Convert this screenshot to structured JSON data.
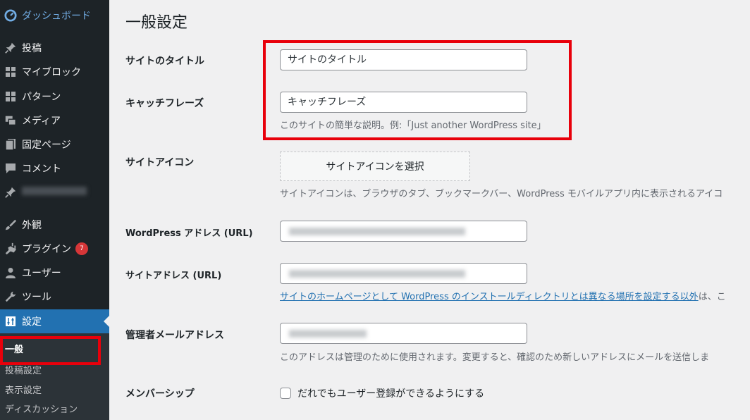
{
  "sidebar": {
    "dashboard": "ダッシュボード",
    "items": [
      {
        "label": "投稿",
        "icon": "pin-icon"
      },
      {
        "label": "マイブロック",
        "icon": "grid-icon"
      },
      {
        "label": "パターン",
        "icon": "grid-icon"
      },
      {
        "label": "メディア",
        "icon": "media-icon"
      },
      {
        "label": "固定ページ",
        "icon": "page-icon"
      },
      {
        "label": "コメント",
        "icon": "comment-icon"
      },
      {
        "label": "",
        "icon": "pin-icon"
      },
      {
        "label": "外観",
        "icon": "brush-icon"
      },
      {
        "label": "プラグイン",
        "icon": "plugin-icon",
        "badge": "7"
      },
      {
        "label": "ユーザー",
        "icon": "user-icon"
      },
      {
        "label": "ツール",
        "icon": "wrench-icon"
      },
      {
        "label": "設定",
        "icon": "settings-icon"
      }
    ],
    "submenu": [
      "一般",
      "投稿設定",
      "表示設定",
      "ディスカッション"
    ]
  },
  "main": {
    "title": "一般設定",
    "site_title": {
      "label": "サイトのタイトル",
      "value": "サイトのタイトル"
    },
    "tagline": {
      "label": "キャッチフレーズ",
      "value": "キャッチフレーズ",
      "description": "このサイトの簡単な説明。例:「Just another WordPress site」"
    },
    "site_icon": {
      "label": "サイトアイコン",
      "button": "サイトアイコンを選択",
      "description": "サイトアイコンは、ブラウザのタブ、ブックマークバー、WordPress モバイルアプリ内に表示されるアイコ"
    },
    "wp_address": {
      "label": "WordPress アドレス (URL)"
    },
    "site_address": {
      "label": "サイトアドレス (URL)",
      "link": "サイトのホームページとして WordPress のインストールディレクトリとは異なる場所を設定する以外",
      "suffix": "は、こ"
    },
    "admin_email": {
      "label": "管理者メールアドレス",
      "description": "このアドレスは管理のために使用されます。変更すると、確認のため新しいアドレスにメールを送信しま"
    },
    "membership": {
      "label": "メンバーシップ",
      "checkbox_label": "だれでもユーザー登録ができるようにする"
    }
  },
  "colors": {
    "sidebar": "#1d2327",
    "active": "#2271b1",
    "highlight": "#e8000b",
    "link": "#2271b1"
  }
}
